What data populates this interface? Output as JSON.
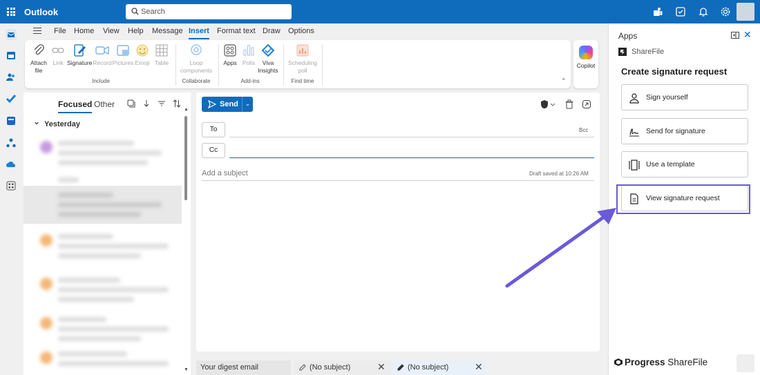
{
  "topbar": {
    "app_title": "Outlook",
    "search_placeholder": "Search"
  },
  "ribbon": {
    "tabs": [
      "File",
      "Home",
      "View",
      "Help",
      "Message",
      "Insert",
      "Format text",
      "Draw",
      "Options"
    ],
    "active_tab": "Insert",
    "buttons": {
      "attach": "Attach file",
      "link": "Link",
      "signature": "Signature",
      "record": "Record",
      "pictures": "Pictures",
      "emoji": "Emoji",
      "table": "Table",
      "loop": "Loop components",
      "apps": "Apps",
      "polls": "Polls",
      "viva": "Viva Insights",
      "scheduling": "Scheduling poll",
      "copilot": "Copilot"
    },
    "groups": {
      "include": "Include",
      "collaborate": "Collaborate",
      "addins": "Add-ins",
      "findtime": "Find time"
    }
  },
  "mail_list": {
    "tab_focused": "Focused",
    "tab_other": "Other",
    "group_label": "Yesterday"
  },
  "compose": {
    "send_label": "Send",
    "to_label": "To",
    "cc_label": "Cc",
    "bcc_label": "Bcc",
    "subject_placeholder": "Add a subject",
    "draft_status": "Draft saved at 10:26 AM"
  },
  "bottom_tabs": {
    "digest": "Your digest email",
    "draft1": "(No subject)",
    "draft2": "(No subject)"
  },
  "apps_panel": {
    "title": "Apps",
    "provider": "ShareFile",
    "heading": "Create signature request",
    "actions": {
      "sign_yourself": "Sign yourself",
      "send_for_signature": "Send for signature",
      "use_template": "Use a template",
      "view_request": "View signature request"
    },
    "brand_progress": "Progress",
    "brand_sharefile": "ShareFile"
  },
  "colors": {
    "brand_blue": "#0f6cbd",
    "highlight": "#6a5ad8"
  }
}
